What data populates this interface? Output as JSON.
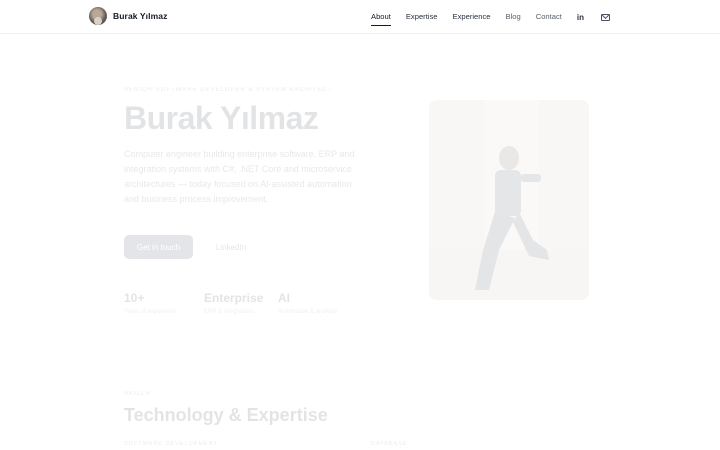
{
  "header": {
    "brand_name": "Burak Yılmaz",
    "nav": [
      "About",
      "Expertise",
      "Experience",
      "Blog",
      "Contact"
    ],
    "linkedin_icon_text": "in",
    "icons": [
      "avatar",
      "linkedin-icon",
      "mail-icon"
    ]
  },
  "hero": {
    "eyebrow": "SENIOR SOFTWARE DEVELOPER & SYSTEM ARCHITECT",
    "title": "Burak Yılmaz",
    "description": "Computer engineer building enterprise software, ERP and integration systems with C#, .NET Core and microservice architectures — today focused on AI-assisted automation and business process improvement.",
    "primary_button": "Get in touch",
    "secondary_button": "LinkedIn",
    "stats": [
      {
        "value": "10+",
        "label": "Years of experience"
      },
      {
        "value": "Enterprise",
        "label": "ERP & integrations"
      },
      {
        "value": "AI",
        "label": "Automation & analysis"
      }
    ]
  },
  "skills": {
    "eyebrow": "SKILLS",
    "title": "Technology & Expertise",
    "categories": [
      "SOFTWARE DEVELOPMENT",
      "DATABASE"
    ]
  },
  "colors": {
    "text": "#1b2333",
    "accent_underline": "#141a26",
    "primary_button": "#2b3347"
  }
}
